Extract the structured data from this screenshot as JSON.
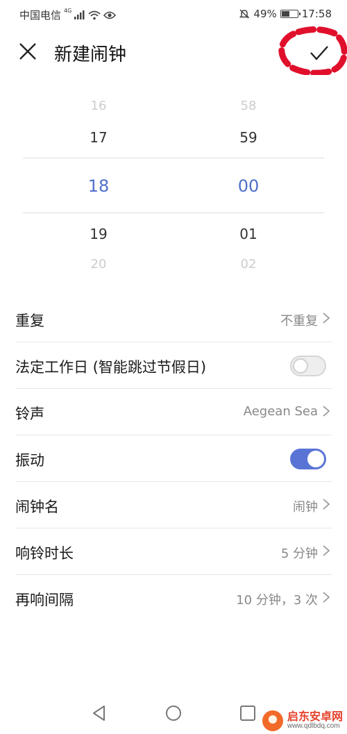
{
  "status_bar": {
    "carrier": "中国电信",
    "network_type": "4G",
    "battery_percent": "49%",
    "battery_level": 0.49,
    "time": "17:58"
  },
  "header": {
    "title": "新建闹钟",
    "close_icon": "close-icon",
    "confirm_icon": "check-icon"
  },
  "picker": {
    "hours": {
      "far_above": "16",
      "above": "17",
      "selected": "18",
      "below": "19",
      "far_below": "20"
    },
    "minutes": {
      "far_above": "58",
      "above": "59",
      "selected": "00",
      "below": "01",
      "far_below": "02"
    }
  },
  "settings": {
    "repeat": {
      "label": "重复",
      "value": "不重复"
    },
    "workday": {
      "label": "法定工作日 (智能跳过节假日)",
      "enabled": false
    },
    "ringtone": {
      "label": "铃声",
      "value": "Aegean Sea"
    },
    "vibrate": {
      "label": "振动",
      "enabled": true
    },
    "alarm_name": {
      "label": "闹钟名",
      "value": "闹钟"
    },
    "ring_duration": {
      "label": "响铃时长",
      "value": "5 分钟"
    },
    "snooze": {
      "label": "再响间隔",
      "value": "10 分钟，3 次"
    }
  },
  "colors": {
    "accent": "#5a74d6",
    "selected_text": "#4f6fc9",
    "annotation": "#e0102c"
  },
  "watermark": {
    "title": "启东安卓网",
    "url": "www.qdlbdq.com"
  }
}
